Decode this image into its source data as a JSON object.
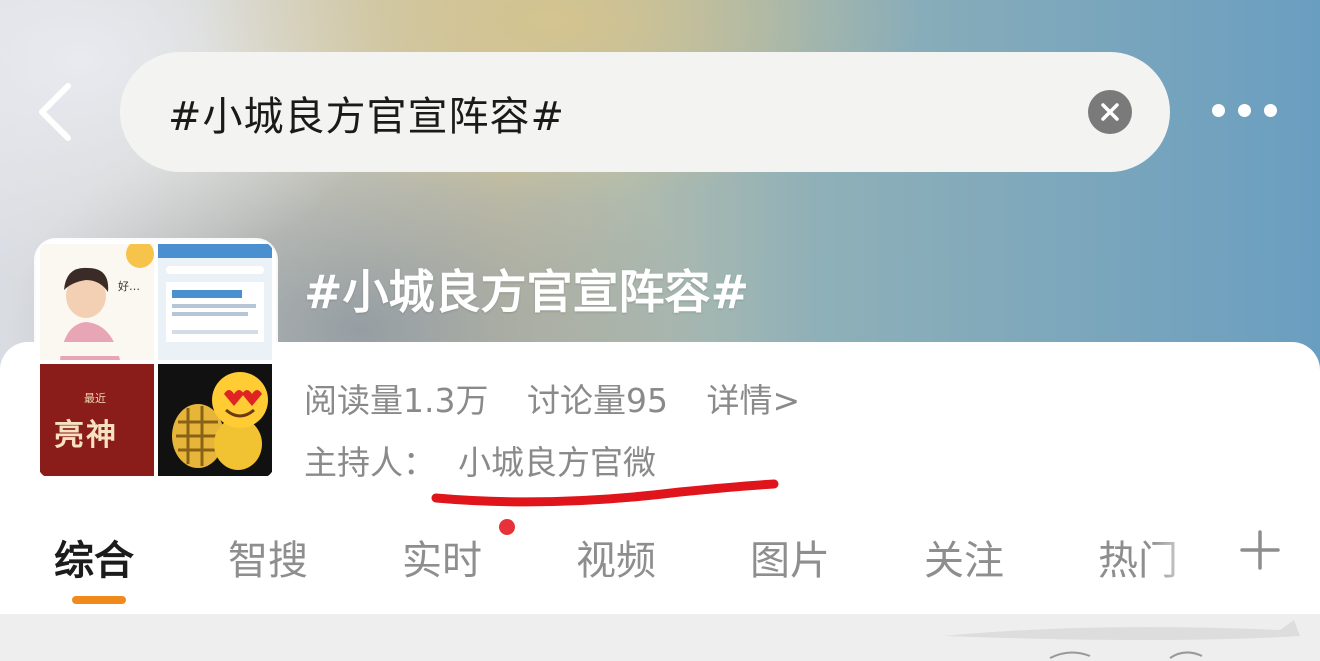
{
  "header": {
    "search_query": "#小城良方官宣阵容#",
    "back_icon": "chevron-left-icon",
    "clear_icon": "close-circle-icon",
    "more_icon": "more-horizontal-icon"
  },
  "topic": {
    "title": "#小城良方官宣阵容#",
    "read_count": "阅读量1.3万",
    "discussion_count": "讨论量95",
    "details_link": "详情>",
    "host_label": "主持人：",
    "host_name": "小城良方官微",
    "thumbnail": {
      "tile1_text": "好…",
      "tile3_small": "最近",
      "tile3_big": "亮神"
    }
  },
  "tabs": [
    {
      "label": "综合",
      "active": true
    },
    {
      "label": "智搜",
      "active": false
    },
    {
      "label": "实时",
      "active": false,
      "badge": "dot"
    },
    {
      "label": "视频",
      "active": false
    },
    {
      "label": "图片",
      "active": false
    },
    {
      "label": "关注",
      "active": false
    },
    {
      "label": "热门",
      "active": false
    }
  ],
  "add_tab_icon": "plus-icon",
  "colors": {
    "active_indicator": "#f08a1c",
    "badge_dot": "#e8323a",
    "annotation_underline": "#e0151b"
  }
}
